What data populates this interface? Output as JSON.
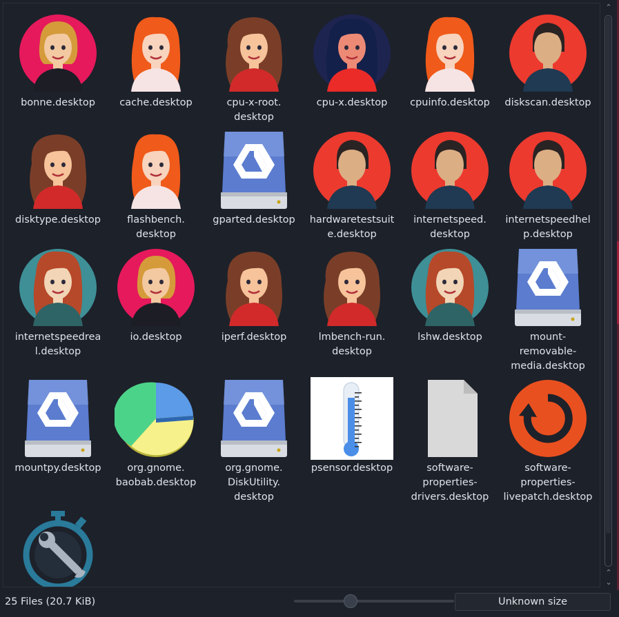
{
  "files": [
    {
      "label": "bonne.desktop",
      "icon": "woman-blonde-avatar-icon"
    },
    {
      "label": "cache.desktop",
      "icon": "woman-redhead-avatar-icon"
    },
    {
      "label": "cpu-x-root.\ndesktop",
      "icon": "woman-brunette-avatar-icon"
    },
    {
      "label": "cpu-x.desktop",
      "icon": "woman-dark-hair-avatar-icon"
    },
    {
      "label": "cpuinfo.desktop",
      "icon": "woman-redhead-avatar-icon"
    },
    {
      "label": "diskscan.desktop",
      "icon": "person-silhouette-avatar-icon"
    },
    {
      "label": "disktype.desktop",
      "icon": "woman-brunette-avatar-icon"
    },
    {
      "label": "flashbench.\ndesktop",
      "icon": "woman-redhead-avatar-icon"
    },
    {
      "label": "gparted.desktop",
      "icon": "drive-icon"
    },
    {
      "label": "hardwaretestsuit\ne.desktop",
      "icon": "person-silhouette-avatar-icon"
    },
    {
      "label": "internetspeed.\ndesktop",
      "icon": "person-silhouette-avatar-icon"
    },
    {
      "label": "internetspeedhel\np.desktop",
      "icon": "person-silhouette-avatar-icon"
    },
    {
      "label": "internetspeedrea\nl.desktop",
      "icon": "woman-teal-avatar-icon"
    },
    {
      "label": "io.desktop",
      "icon": "woman-blonde-avatar-icon"
    },
    {
      "label": "iperf.desktop",
      "icon": "woman-brunette-avatar-icon"
    },
    {
      "label": "lmbench-run.\ndesktop",
      "icon": "woman-brunette-avatar-icon"
    },
    {
      "label": "lshw.desktop",
      "icon": "woman-teal-avatar-icon"
    },
    {
      "label": "mount-\nremovable-\nmedia.desktop",
      "icon": "drive-icon"
    },
    {
      "label": "mountpy.desktop",
      "icon": "drive-icon"
    },
    {
      "label": "org.gnome.\nbaobab.desktop",
      "icon": "pie-chart-icon"
    },
    {
      "label": "org.gnome.\nDiskUtility.\ndesktop",
      "icon": "drive-icon"
    },
    {
      "label": "psensor.desktop",
      "icon": "thermometer-icon"
    },
    {
      "label": "software-\nproperties-\ndrivers.desktop",
      "icon": "blank-document-icon"
    },
    {
      "label": "software-\nproperties-\nlivepatch.desktop",
      "icon": "livepatch-icon"
    },
    {
      "label": "",
      "icon": "stopwatch-wrench-icon"
    }
  ],
  "status": {
    "file_count": "25 Files (20.7 KiB)",
    "size_text": "Unknown size"
  },
  "colors": {
    "background": "#1d212a",
    "text": "#dfe3ea"
  }
}
